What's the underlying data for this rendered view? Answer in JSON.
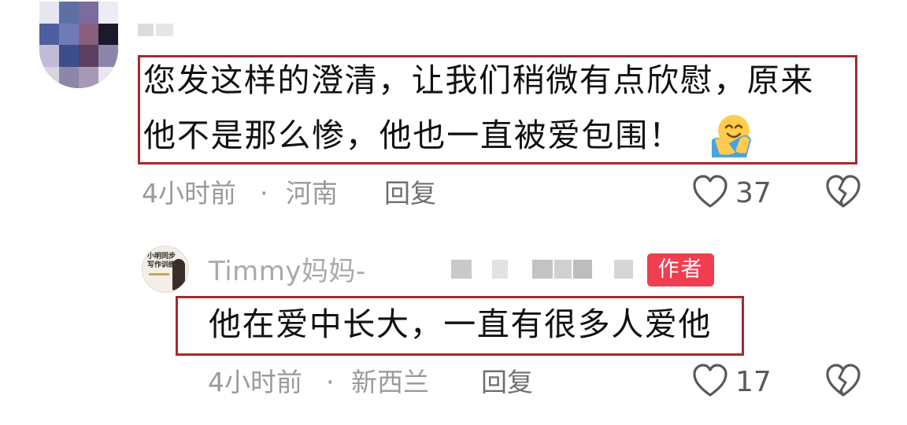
{
  "comment": {
    "text_line1": "您发这样的澄清，让我们稍微有点欣慰，原来",
    "text_line2": "他不是那么惨，他也一直被爱包围！",
    "emoji": "hugging-face-icon",
    "time": "4小时前",
    "separator": "·",
    "location": "河南",
    "reply_label": "回复",
    "likes": "37"
  },
  "reply": {
    "username": "Timmy妈妈-",
    "author_badge": "作者",
    "text": "他在爱中长大，一直有很多人爱他",
    "time": "4小时前",
    "separator": "·",
    "location": "新西兰",
    "reply_label": "回复",
    "likes": "17"
  },
  "colors": {
    "highlight_border": "#a52a2a",
    "author_badge_bg": "#f03d4f",
    "meta_text": "#9a9a9a"
  },
  "icons": [
    "heart-outline-icon",
    "broken-heart-icon"
  ]
}
